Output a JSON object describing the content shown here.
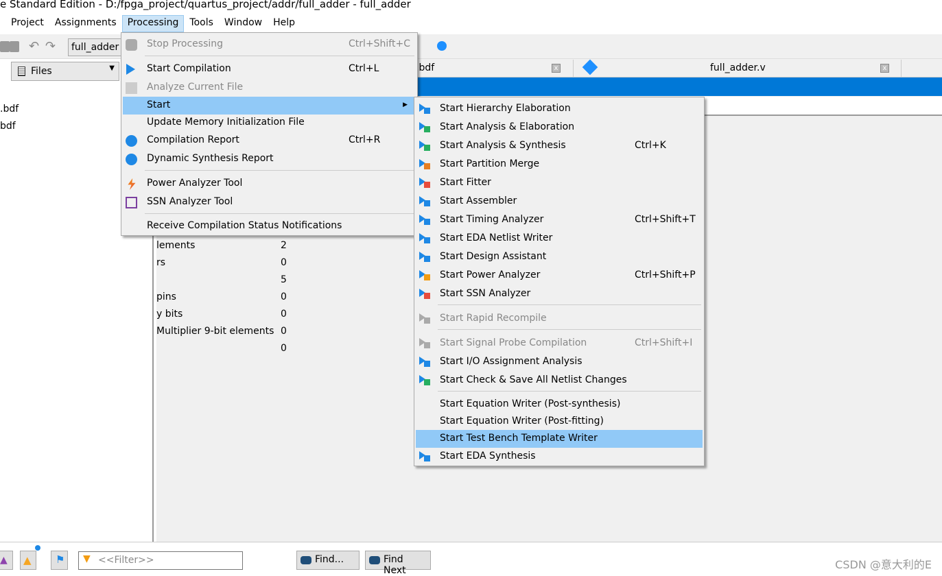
{
  "window": {
    "title": "e Standard Edition - D:/fpga_project/quartus_project/addr/full_adder - full_adder"
  },
  "menubar": [
    "Project",
    "Assignments",
    "Processing",
    "Tools",
    "Window",
    "Help"
  ],
  "toolbar": {
    "entity_combo": "full_adder"
  },
  "left_panel": {
    "dropdown": "Files",
    "files": [
      ".bdf",
      "bdf"
    ]
  },
  "tabs": [
    {
      "label": "er.bdf"
    },
    {
      "label": "full_adder.v",
      "icon": "verilog-file-icon"
    }
  ],
  "report_rows": [
    {
      "label": "lements",
      "value": "2"
    },
    {
      "label": "rs",
      "value": "0"
    },
    {
      "label": "",
      "value": "5"
    },
    {
      "label": "pins",
      "value": "0"
    },
    {
      "label": "y bits",
      "value": "0"
    },
    {
      "label": "Multiplier 9-bit elements",
      "value": "0"
    },
    {
      "label": "",
      "value": "0"
    }
  ],
  "processing_menu": [
    {
      "label": "Stop Processing",
      "shortcut": "Ctrl+Shift+C",
      "disabled": true,
      "icon": "stop-icon"
    },
    {
      "label": "Start Compilation",
      "shortcut": "Ctrl+L",
      "icon": "play-icon"
    },
    {
      "label": "Analyze Current File",
      "shortcut": "",
      "disabled": true,
      "icon": "analyze-file-icon"
    },
    {
      "label": "Start",
      "shortcut": "",
      "submenu": true
    },
    {
      "label": "Update Memory Initialization File",
      "shortcut": ""
    },
    {
      "label": "Compilation Report",
      "shortcut": "Ctrl+R",
      "icon": "report-icon"
    },
    {
      "label": "Dynamic Synthesis Report",
      "shortcut": "",
      "icon": "report-icon"
    },
    {
      "label": "Power Analyzer Tool",
      "shortcut": "",
      "icon": "power-icon"
    },
    {
      "label": "SSN Analyzer Tool",
      "shortcut": "",
      "icon": "ssn-icon"
    },
    {
      "label": "Receive Compilation Status Notifications",
      "shortcut": ""
    }
  ],
  "start_submenu": [
    {
      "label": "Start Hierarchy Elaboration",
      "shortcut": ""
    },
    {
      "label": "Start Analysis & Elaboration",
      "shortcut": ""
    },
    {
      "label": "Start Analysis & Synthesis",
      "shortcut": "Ctrl+K"
    },
    {
      "label": "Start Partition Merge",
      "shortcut": ""
    },
    {
      "label": "Start Fitter",
      "shortcut": ""
    },
    {
      "label": "Start Assembler",
      "shortcut": ""
    },
    {
      "label": "Start Timing Analyzer",
      "shortcut": "Ctrl+Shift+T"
    },
    {
      "label": "Start EDA Netlist Writer",
      "shortcut": ""
    },
    {
      "label": "Start Design Assistant",
      "shortcut": ""
    },
    {
      "label": "Start Power Analyzer",
      "shortcut": "Ctrl+Shift+P"
    },
    {
      "label": "Start SSN Analyzer",
      "shortcut": ""
    },
    {
      "label": "Start Rapid Recompile",
      "shortcut": "",
      "disabled": true
    },
    {
      "label": "Start Signal Probe Compilation",
      "shortcut": "Ctrl+Shift+I",
      "disabled": true
    },
    {
      "label": "Start I/O Assignment Analysis",
      "shortcut": ""
    },
    {
      "label": "Start Check & Save All Netlist Changes",
      "shortcut": ""
    },
    {
      "label": "Start Equation Writer (Post-synthesis)",
      "shortcut": ""
    },
    {
      "label": "Start Equation Writer (Post-fitting)",
      "shortcut": ""
    },
    {
      "label": "Start Test Bench Template Writer",
      "shortcut": "",
      "highlighted": true
    },
    {
      "label": "Start EDA Synthesis",
      "shortcut": ""
    }
  ],
  "bottom": {
    "filter_placeholder": "<<Filter>>",
    "find": "Find...",
    "find_next": "Find Next"
  },
  "watermark": "CSDN @意大利的E",
  "colors": {
    "accent": "#0078d7",
    "highlight": "#91c9f7",
    "menu_bg": "#f0f0f0"
  }
}
